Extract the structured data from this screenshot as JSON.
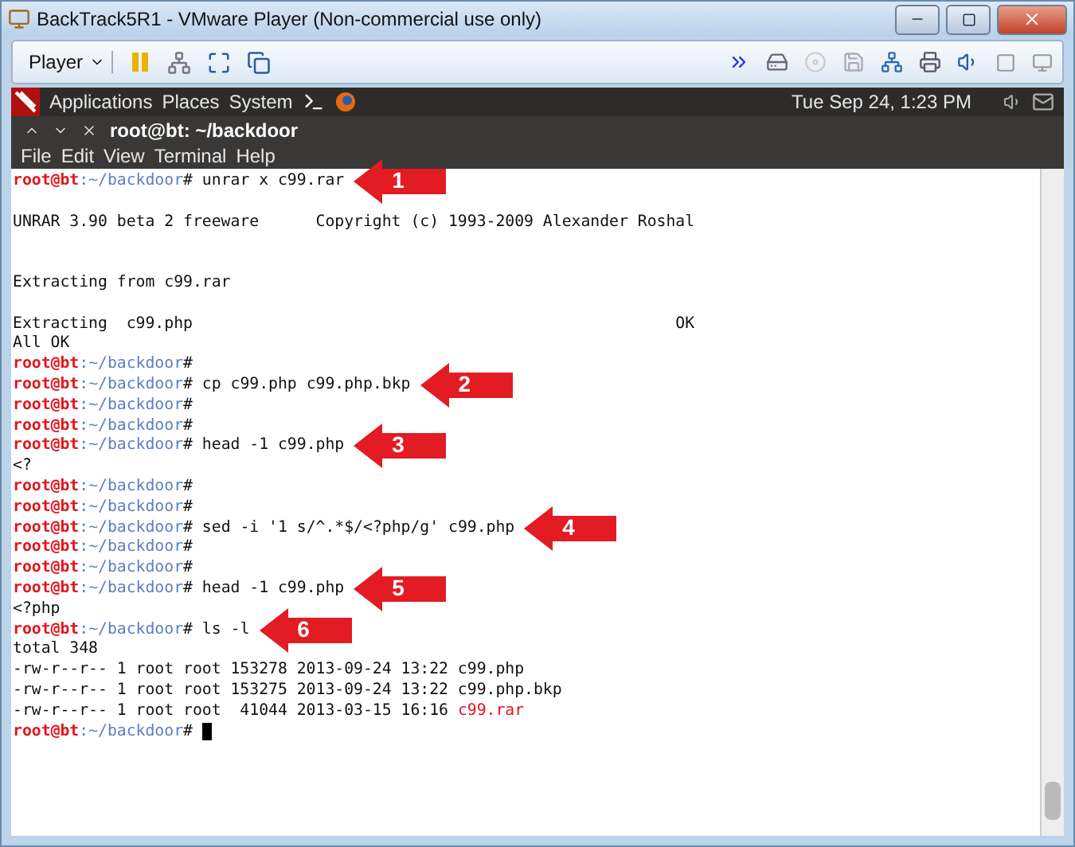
{
  "window": {
    "title": "BackTrack5R1 - VMware Player (Non-commercial use only)"
  },
  "player_toolbar": {
    "menu": "Player"
  },
  "panel": {
    "menus": [
      "Applications",
      "Places",
      "System"
    ],
    "clock": "Tue Sep 24,  1:23 PM"
  },
  "terminal": {
    "tab_title": "root@bt: ~/backdoor",
    "menu": [
      "File",
      "Edit",
      "View",
      "Terminal",
      "Help"
    ],
    "lines": [
      {
        "kind": "prompt",
        "user": "root@bt",
        "path": ":~/backdoor",
        "symbol": "#",
        "command": " unrar x c99.rar",
        "callout": "1"
      },
      {
        "kind": "blank"
      },
      {
        "kind": "output",
        "text": "UNRAR 3.90 beta 2 freeware      Copyright (c) 1993-2009 Alexander Roshal"
      },
      {
        "kind": "blank"
      },
      {
        "kind": "blank"
      },
      {
        "kind": "output",
        "text": "Extracting from c99.rar"
      },
      {
        "kind": "blank"
      },
      {
        "kind": "output",
        "text": "Extracting  c99.php                                                   OK"
      },
      {
        "kind": "output",
        "text": "All OK"
      },
      {
        "kind": "prompt",
        "user": "root@bt",
        "path": ":~/backdoor",
        "symbol": "#"
      },
      {
        "kind": "prompt",
        "user": "root@bt",
        "path": ":~/backdoor",
        "symbol": "#",
        "command": " cp c99.php c99.php.bkp",
        "callout": "2"
      },
      {
        "kind": "prompt",
        "user": "root@bt",
        "path": ":~/backdoor",
        "symbol": "#"
      },
      {
        "kind": "prompt",
        "user": "root@bt",
        "path": ":~/backdoor",
        "symbol": "#"
      },
      {
        "kind": "prompt",
        "user": "root@bt",
        "path": ":~/backdoor",
        "symbol": "#",
        "command": " head -1 c99.php",
        "callout": "3"
      },
      {
        "kind": "output",
        "text": "<?"
      },
      {
        "kind": "prompt",
        "user": "root@bt",
        "path": ":~/backdoor",
        "symbol": "#"
      },
      {
        "kind": "prompt",
        "user": "root@bt",
        "path": ":~/backdoor",
        "symbol": "#"
      },
      {
        "kind": "prompt",
        "user": "root@bt",
        "path": ":~/backdoor",
        "symbol": "#",
        "command": " sed -i '1 s/^.*$/<?php/g' c99.php",
        "callout": "4"
      },
      {
        "kind": "prompt",
        "user": "root@bt",
        "path": ":~/backdoor",
        "symbol": "#"
      },
      {
        "kind": "prompt",
        "user": "root@bt",
        "path": ":~/backdoor",
        "symbol": "#"
      },
      {
        "kind": "prompt",
        "user": "root@bt",
        "path": ":~/backdoor",
        "symbol": "#",
        "command": " head -1 c99.php",
        "callout": "5"
      },
      {
        "kind": "output",
        "text": "<?php"
      },
      {
        "kind": "prompt",
        "user": "root@bt",
        "path": ":~/backdoor",
        "symbol": "#",
        "command": " ls -l",
        "callout": "6"
      },
      {
        "kind": "output",
        "text": "total 348"
      },
      {
        "kind": "output",
        "text": "-rw-r--r-- 1 root root 153278 2013-09-24 13:22 c99.php"
      },
      {
        "kind": "output",
        "text": "-rw-r--r-- 1 root root 153275 2013-09-24 13:22 c99.php.bkp"
      },
      {
        "kind": "output",
        "text": "-rw-r--r-- 1 root root  41044 2013-03-15 16:16 ",
        "archive": "c99.rar"
      },
      {
        "kind": "prompt",
        "user": "root@bt",
        "path": ":~/backdoor",
        "symbol": "#",
        "cursor": true
      }
    ]
  }
}
